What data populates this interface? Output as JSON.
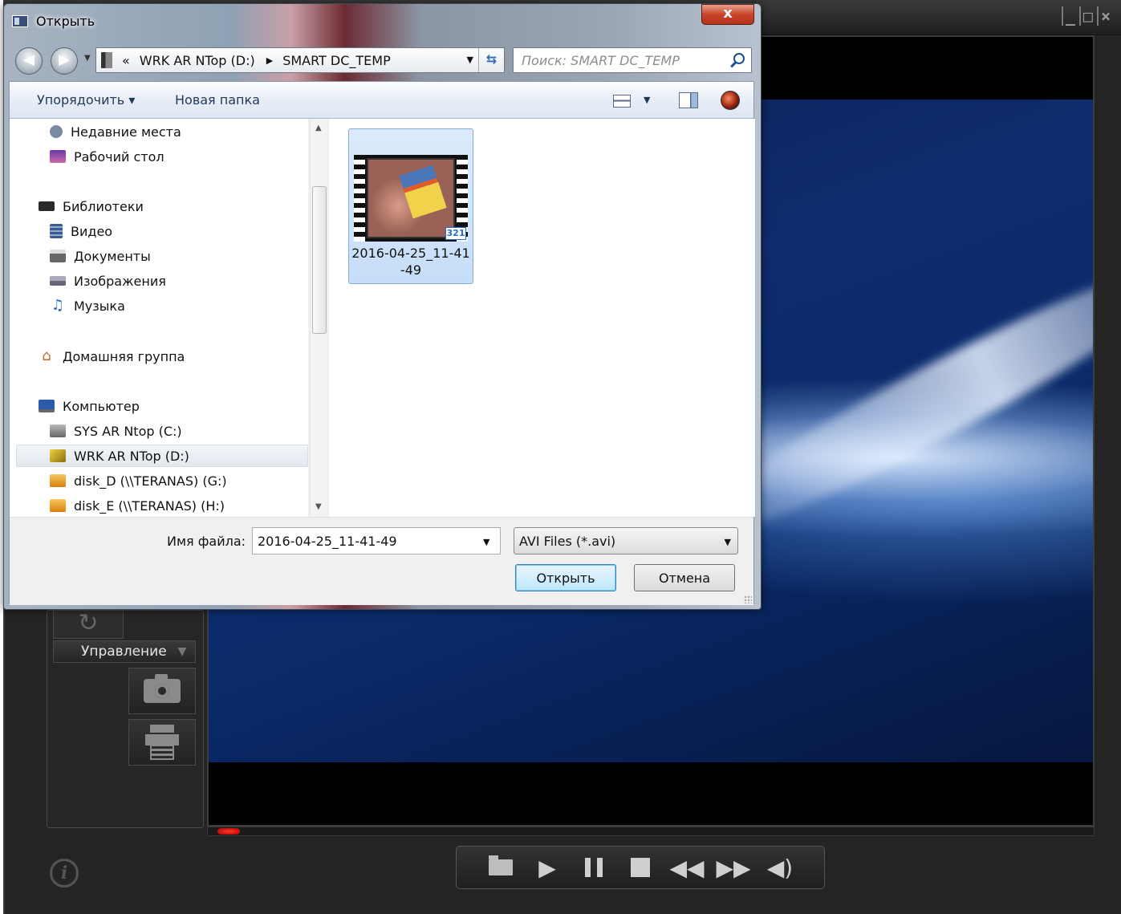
{
  "player": {
    "window_controls": [
      "_",
      "□",
      "×"
    ],
    "manage_label": "Управление",
    "info_icon": "i",
    "progress_fraction": 0.0,
    "controls": [
      "open-folder-icon",
      "play-icon",
      "pause-icon",
      "stop-icon",
      "rewind-icon",
      "fast-forward-icon",
      "volume-icon"
    ]
  },
  "dialog": {
    "title": "Открыть",
    "close_label": "x",
    "address": {
      "overflow": "«",
      "segments": [
        "WRK AR NTop (D:)",
        "SMART DC_TEMP"
      ]
    },
    "search": {
      "placeholder": "Поиск: SMART DC_TEMP"
    },
    "toolbar": {
      "organize": "Упорядочить ▾",
      "new_folder": "Новая папка"
    },
    "nav": [
      {
        "label": "Недавние места",
        "icon": "recent-places-icon",
        "color": "#7a8aa0"
      },
      {
        "label": "Рабочий стол",
        "icon": "desktop-icon",
        "color": "#5a3a8a"
      },
      {
        "label": "Библиотеки",
        "icon": "libraries-icon",
        "color": "#3a3a3a"
      },
      {
        "label": "Видео",
        "icon": "video-icon",
        "color": "#3a5a9a"
      },
      {
        "label": "Документы",
        "icon": "documents-icon",
        "color": "#6a6a6a"
      },
      {
        "label": "Изображения",
        "icon": "pictures-icon",
        "color": "#8a9aaa"
      },
      {
        "label": "Музыка",
        "icon": "music-icon",
        "color": "#2a6ac8"
      },
      {
        "label": "Домашняя группа",
        "icon": "homegroup-icon",
        "color": "#c8642a"
      },
      {
        "label": "Компьютер",
        "icon": "computer-icon",
        "color": "#2a5aa8"
      },
      {
        "label": "SYS AR Ntop (C:)",
        "icon": "drive-c-icon",
        "color": "#8a8a8a"
      },
      {
        "label": "WRK AR NTop (D:)",
        "icon": "drive-d-icon",
        "color": "#d8b020"
      },
      {
        "label": "disk_D (\\\\TERANAS) (G:)",
        "icon": "network-drive-g-icon",
        "color": "#e8a030"
      },
      {
        "label": "disk_E (\\\\TERANAS) (H:)",
        "icon": "network-drive-h-icon",
        "color": "#e8a030"
      }
    ],
    "file": {
      "name": "2016-04-25_11-41-49",
      "name_line1": "2016-04-25_11-41",
      "name_line2": "-49",
      "badge": "321"
    },
    "filename_label": "Имя файла:",
    "filename_value": "2016-04-25_11-41-49",
    "filetype": "AVI Files (*.avi)",
    "open_button": "Открыть",
    "cancel_button": "Отмена"
  }
}
